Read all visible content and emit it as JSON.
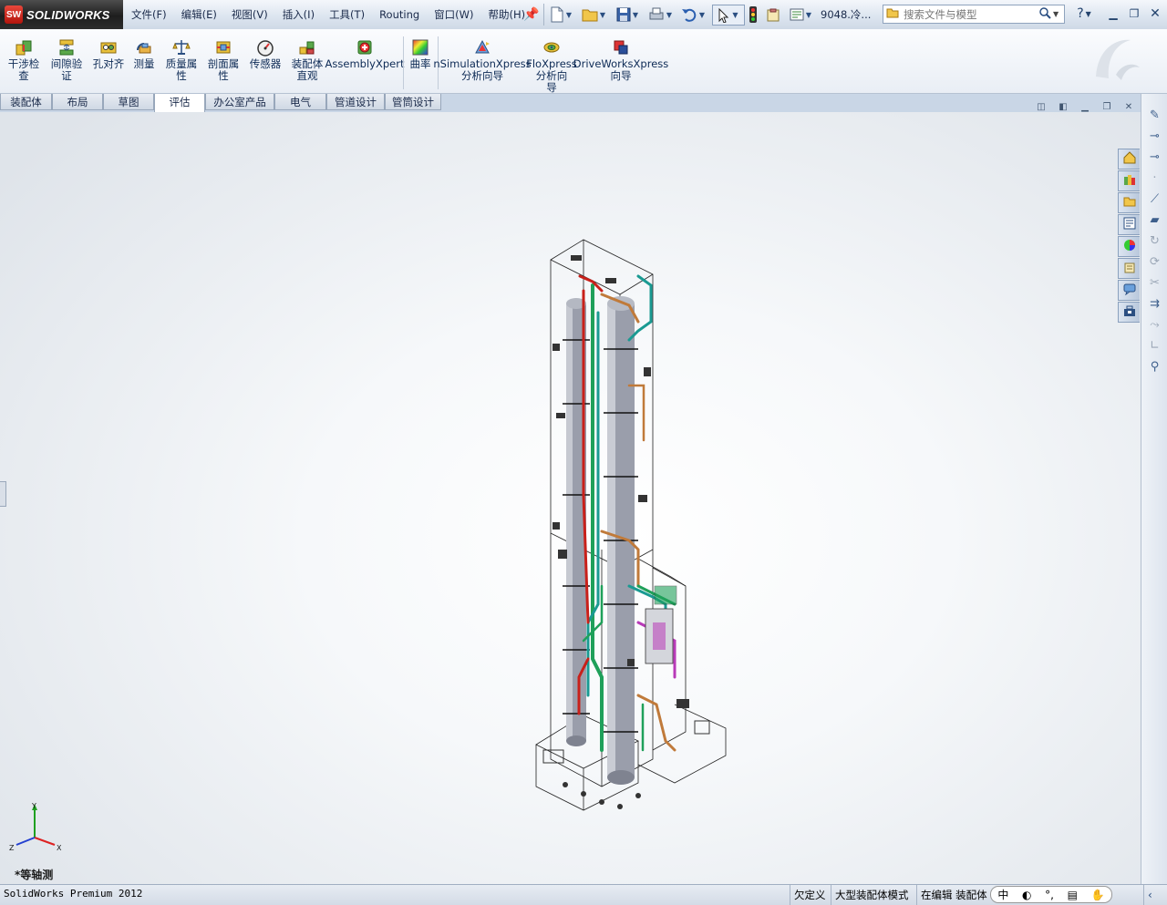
{
  "app": {
    "brand": "SOLIDWORKS",
    "badge": "SW",
    "status_title": "SolidWorks Premium 2012"
  },
  "menu": [
    "文件(F)",
    "编辑(E)",
    "视图(V)",
    "插入(I)",
    "工具(T)",
    "Routing",
    "窗口(W)",
    "帮助(H)"
  ],
  "document_name": "9048.冷...",
  "search": {
    "placeholder": "搜索文件与模型"
  },
  "help_label": "?",
  "commands": [
    {
      "label": "干涉检\n查",
      "icon": "interference-check-icon"
    },
    {
      "label": "间隙验\n证",
      "icon": "clearance-verification-icon"
    },
    {
      "label": "孔对齐",
      "icon": "hole-alignment-icon"
    },
    {
      "label": "测量",
      "icon": "measure-icon"
    },
    {
      "label": "质量属\n性",
      "icon": "mass-properties-icon"
    },
    {
      "label": "剖面属\n性",
      "icon": "section-properties-icon"
    },
    {
      "label": "传感器",
      "icon": "sensor-icon"
    },
    {
      "label": "装配体\n直观",
      "icon": "assemblyxpert-visualize-icon"
    },
    {
      "label": "AssemblyXpert",
      "icon": "assemblyxpert-icon"
    },
    {
      "label": "曲率",
      "icon": "curvature-icon"
    },
    {
      "label": "nSimulationXpress\n分析向导",
      "icon": "simulationxpress-icon"
    },
    {
      "label": "FloXpress\n分析向\n导",
      "icon": "floxpress-icon"
    },
    {
      "label": "DriveWorksXpress\n向导",
      "icon": "driveworksxpress-icon"
    }
  ],
  "tabs": [
    {
      "label": "装配体",
      "active": false
    },
    {
      "label": "布局",
      "active": false
    },
    {
      "label": "草图",
      "active": false
    },
    {
      "label": "评估",
      "active": true
    },
    {
      "label": "办公室产品",
      "active": false
    },
    {
      "label": "电气",
      "active": false
    },
    {
      "label": "管道设计",
      "active": false
    },
    {
      "label": "管筒设计",
      "active": false
    }
  ],
  "view_label": "*等轴测",
  "triad": {
    "x": "X",
    "y": "Y",
    "z": "Z"
  },
  "status": {
    "definition": "欠定义",
    "mode": "大型装配体模式",
    "editing": "在编辑 装配体",
    "ime": [
      "中",
      "◐",
      "°,",
      "▤",
      "✋"
    ]
  },
  "colors": {
    "pipe_green": "#1fa05a",
    "pipe_teal": "#1a9a92",
    "pipe_orange": "#c07a3a",
    "pipe_red": "#c8201a",
    "vessel": "#9a9eab"
  }
}
